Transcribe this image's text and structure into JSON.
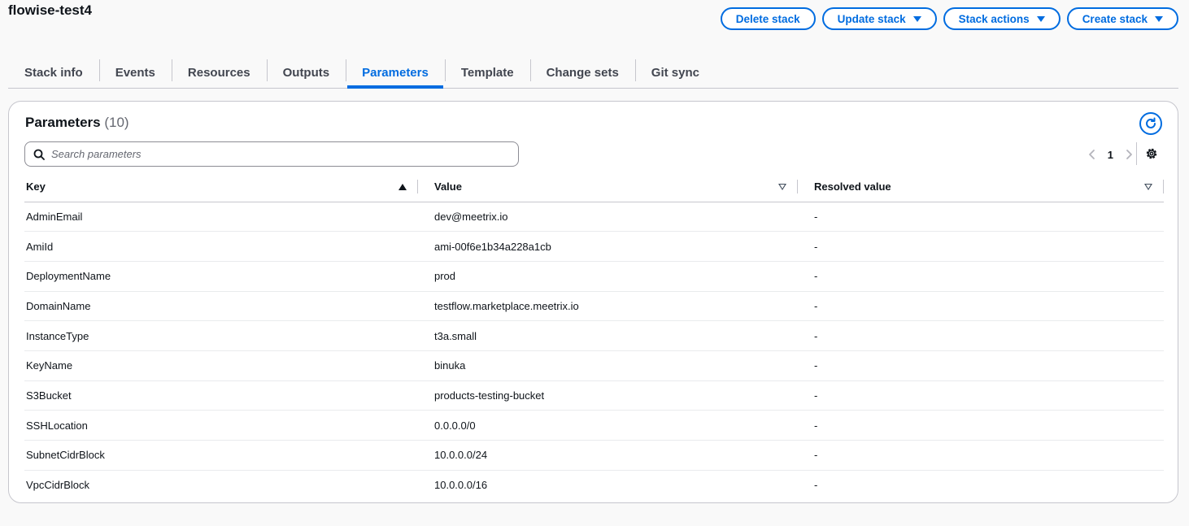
{
  "header": {
    "title": "flowise-test4"
  },
  "actions": {
    "delete": "Delete stack",
    "update": "Update stack",
    "stack_actions": "Stack actions",
    "create": "Create stack"
  },
  "tabs": [
    {
      "label": "Stack info"
    },
    {
      "label": "Events"
    },
    {
      "label": "Resources"
    },
    {
      "label": "Outputs"
    },
    {
      "label": "Parameters",
      "active": true
    },
    {
      "label": "Template"
    },
    {
      "label": "Change sets"
    },
    {
      "label": "Git sync"
    }
  ],
  "panel": {
    "title": "Parameters",
    "count": "(10)",
    "search_placeholder": "Search parameters",
    "page": "1"
  },
  "table": {
    "columns": {
      "key": "Key",
      "value": "Value",
      "resolved": "Resolved value"
    },
    "rows": [
      {
        "key": "AdminEmail",
        "value": "dev@meetrix.io",
        "resolved": "-"
      },
      {
        "key": "AmiId",
        "value": "ami-00f6e1b34a228a1cb",
        "resolved": "-"
      },
      {
        "key": "DeploymentName",
        "value": "prod",
        "resolved": "-"
      },
      {
        "key": "DomainName",
        "value": "testflow.marketplace.meetrix.io",
        "resolved": "-"
      },
      {
        "key": "InstanceType",
        "value": "t3a.small",
        "resolved": "-"
      },
      {
        "key": "KeyName",
        "value": "binuka",
        "resolved": "-"
      },
      {
        "key": "S3Bucket",
        "value": "products-testing-bucket",
        "resolved": "-"
      },
      {
        "key": "SSHLocation",
        "value": "0.0.0.0/0",
        "resolved": "-"
      },
      {
        "key": "SubnetCidrBlock",
        "value": "10.0.0.0/24",
        "resolved": "-"
      },
      {
        "key": "VpcCidrBlock",
        "value": "10.0.0.0/16",
        "resolved": "-"
      }
    ]
  },
  "colors": {
    "accent": "#006ce0",
    "border": "#c6c6cd",
    "text": "#0f141a"
  },
  "icons": [
    "caret-down-icon",
    "refresh-icon",
    "search-icon",
    "chevron-left-icon",
    "chevron-right-icon",
    "gear-icon",
    "sort-ascending-icon",
    "sort-icon"
  ]
}
